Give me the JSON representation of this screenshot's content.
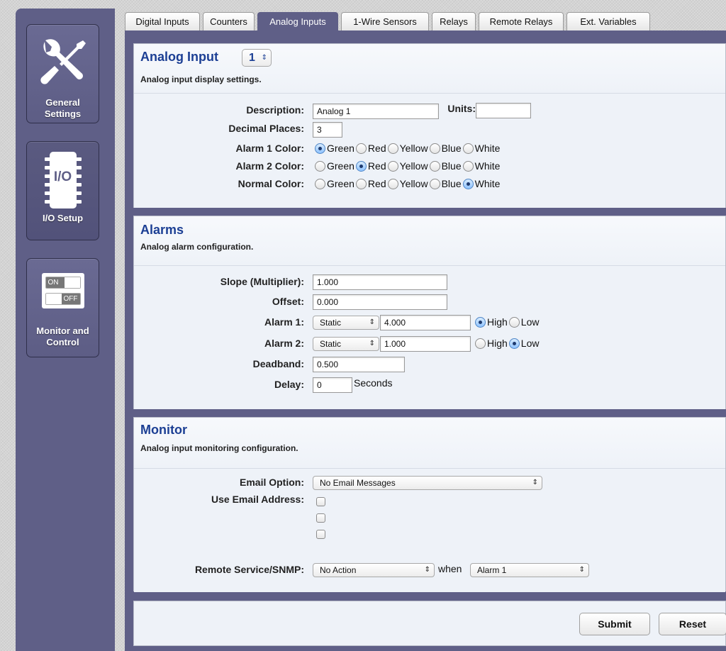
{
  "sidebar": {
    "items": [
      {
        "label": "General Settings",
        "icon": "tools-icon"
      },
      {
        "label": "I/O Setup",
        "icon": "io-chip-icon",
        "chip_text": "I/O"
      },
      {
        "label": "Monitor and Control",
        "icon": "on-off-switch-icon",
        "on_text": "ON",
        "off_text": "OFF"
      }
    ]
  },
  "tabs": [
    {
      "label": "Digital Inputs"
    },
    {
      "label": "Counters"
    },
    {
      "label": "Analog Inputs",
      "active": true
    },
    {
      "label": "1-Wire Sensors"
    },
    {
      "label": "Relays"
    },
    {
      "label": "Remote Relays"
    },
    {
      "label": "Ext. Variables"
    }
  ],
  "analog_input": {
    "title": "Analog Input",
    "selector_value": "1",
    "subtitle": "Analog input display settings.",
    "description_label": "Description:",
    "description_value": "Analog 1",
    "units_label": "Units:",
    "units_value": "",
    "decimal_label": "Decimal Places:",
    "decimal_value": "3",
    "color_options": [
      "Green",
      "Red",
      "Yellow",
      "Blue",
      "White"
    ],
    "alarm1_color_label": "Alarm 1 Color:",
    "alarm1_color_selected": "Green",
    "alarm2_color_label": "Alarm 2 Color:",
    "alarm2_color_selected": "Red",
    "normal_color_label": "Normal Color:",
    "normal_color_selected": "White"
  },
  "alarms": {
    "title": "Alarms",
    "subtitle": "Analog alarm configuration.",
    "slope_label": "Slope (Multiplier):",
    "slope_value": "1.000",
    "offset_label": "Offset:",
    "offset_value": "0.000",
    "alarm1_label": "Alarm 1:",
    "alarm1_mode": "Static",
    "alarm1_value": "4.000",
    "alarm1_direction": "High",
    "alarm2_label": "Alarm 2:",
    "alarm2_mode": "Static",
    "alarm2_value": "1.000",
    "alarm2_direction": "Low",
    "high_label": "High",
    "low_label": "Low",
    "deadband_label": "Deadband:",
    "deadband_value": "0.500",
    "delay_label": "Delay:",
    "delay_value": "0",
    "delay_units": "Seconds"
  },
  "monitor": {
    "title": "Monitor",
    "subtitle": "Analog input monitoring configuration.",
    "email_option_label": "Email Option:",
    "email_option_value": "No Email Messages",
    "use_email_label": "Use Email Address:",
    "email_checkboxes": [
      false,
      false,
      false
    ],
    "remote_label": "Remote Service/SNMP:",
    "remote_value": "No Action",
    "when_label": "when",
    "when_value": "Alarm 1"
  },
  "actions": {
    "submit_label": "Submit",
    "reset_label": "Reset"
  },
  "colors": {
    "sidebar_bg": "#5f5f87",
    "heading_blue": "#1c3f94",
    "panel_bg": "#eef2f8"
  }
}
